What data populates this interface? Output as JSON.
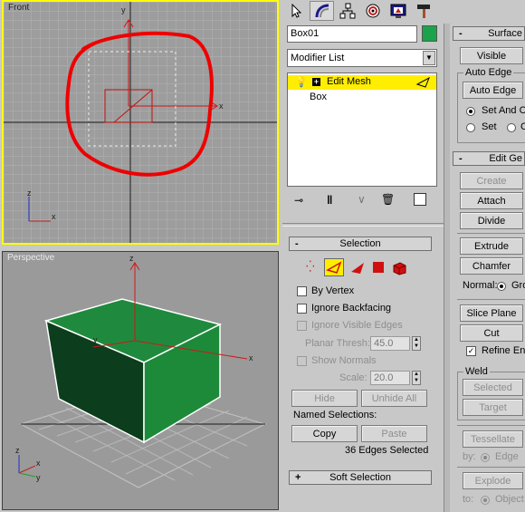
{
  "viewports": {
    "front": {
      "label": "Front"
    },
    "perspective": {
      "label": "Perspective"
    },
    "axis": {
      "x": "x",
      "y": "y",
      "z": "z"
    }
  },
  "panel_tabs": [
    "create-tab",
    "modify-tab",
    "hierarchy-tab",
    "motion-tab",
    "display-tab",
    "utilities-tab"
  ],
  "object": {
    "name": "Box01",
    "color": "#1aa34a"
  },
  "modifier_list": {
    "label": "Modifier List"
  },
  "stack": {
    "items": [
      "Edit Mesh",
      "Box"
    ]
  },
  "selection": {
    "title": "Selection",
    "by_vertex": "By Vertex",
    "ignore_backfacing": "Ignore Backfacing",
    "ignore_visible_edges": "Ignore Visible Edges",
    "planar_thresh_label": "Planar Thresh:",
    "planar_thresh_value": "45.0",
    "show_normals": "Show Normals",
    "scale_label": "Scale:",
    "scale_value": "20.0",
    "hide": "Hide",
    "unhide_all": "Unhide All",
    "named_selections": "Named Selections:",
    "copy": "Copy",
    "paste": "Paste",
    "status": "36 Edges Selected"
  },
  "soft_selection": {
    "title": "Soft Selection"
  },
  "surface": {
    "title": "Surface",
    "visible": "Visible",
    "auto_edge_group": "Auto Edge",
    "auto_edge": "Auto Edge",
    "set_and_c": "Set And C",
    "set": "Set",
    "c": "C"
  },
  "edit_geometry": {
    "title": "Edit Ge",
    "create": "Create",
    "attach": "Attach",
    "divide": "Divide",
    "extrude": "Extrude",
    "chamfer": "Chamfer",
    "normal_label": "Normal:",
    "normal_value": "Gro",
    "slice_plane": "Slice Plane",
    "cut": "Cut",
    "refine_ends": "Refine En",
    "weld_group": "Weld",
    "selected": "Selected",
    "target": "Target",
    "tessellate": "Tessellate",
    "by_label": "by:",
    "edge": "Edge",
    "explode": "Explode",
    "to_label": "to:",
    "objects": "Object"
  }
}
